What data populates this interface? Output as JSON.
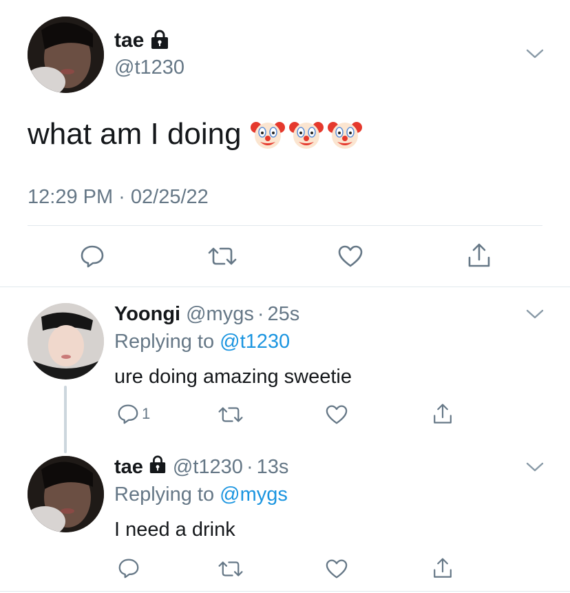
{
  "main_tweet": {
    "display_name": "tae",
    "handle": "@t1230",
    "text": "what am I doing",
    "emojis": [
      "clown-face",
      "clown-face",
      "clown-face"
    ],
    "timestamp": "12:29 PM · 02/25/22"
  },
  "replies": [
    {
      "display_name": "Yoongi",
      "handle": "@mygs",
      "time": "25s",
      "replying_to_label": "Replying to",
      "replying_to_handle": "@t1230",
      "text": "ure doing amazing sweetie",
      "reply_count": "1"
    },
    {
      "display_name": "tae",
      "handle": "@t1230",
      "time": "13s",
      "replying_to_label": "Replying to",
      "replying_to_handle": "@mygs",
      "text": "I need a drink"
    }
  ],
  "separator": "·",
  "icons": {
    "reply": "reply-icon",
    "retweet": "retweet-icon",
    "like": "heart-icon",
    "share": "share-icon",
    "more": "chevron-down-icon",
    "lock": "lock-icon"
  },
  "colors": {
    "text": "#14171a",
    "muted": "#657786",
    "link": "#1b95e0",
    "divider": "#e1e8ed"
  }
}
